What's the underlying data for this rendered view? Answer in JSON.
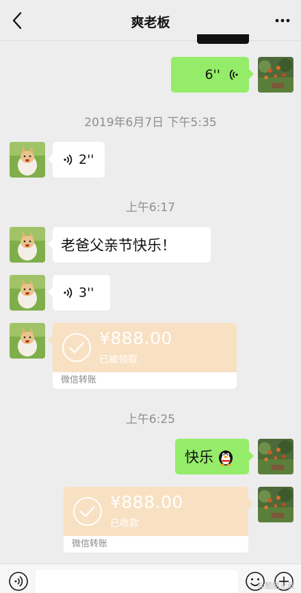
{
  "header": {
    "title": "爽老板"
  },
  "messages": {
    "m1_voice_sent": "6''",
    "ts1": "2019年6月7日 下午5:35",
    "m2_voice_recv": "2''",
    "ts2": "上午6:17",
    "m3_text_recv": "老爸父亲节快乐！",
    "m4_voice_recv": "3''",
    "m5_transfer_recv": {
      "amount": "¥888.00",
      "status": "已被领取",
      "label": "微信转账"
    },
    "ts3": "上午6:25",
    "m6_text_sent": "快乐",
    "m7_transfer_sent": {
      "amount": "¥888.00",
      "status": "已收款",
      "label": "微信转账"
    }
  },
  "watermark": "@酷酷无敌",
  "icons": {
    "back": "back-arrow-icon",
    "more": "more-dots-icon",
    "voice": "voice-wave-icon",
    "check": "check-circle-icon",
    "emoji": "emoji-icon",
    "plus": "plus-icon",
    "penguin": "penguin-emoji-icon"
  },
  "colors": {
    "green_bubble": "#95ec69",
    "transfer": "#f8e0c2",
    "bg": "#ededed"
  }
}
